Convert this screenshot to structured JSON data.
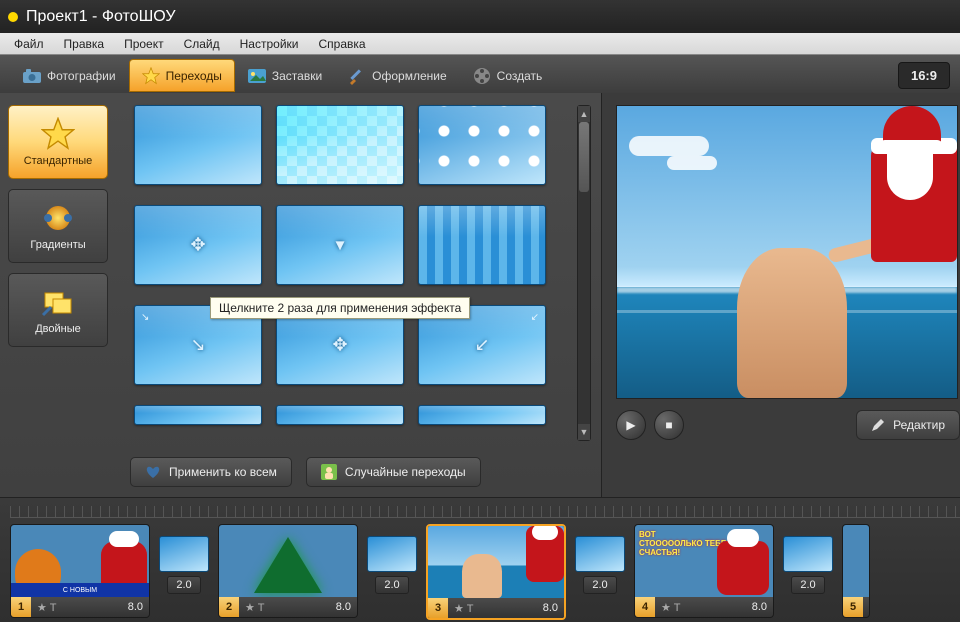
{
  "title": "Проект1 - ФотоШОУ",
  "menu": [
    "Файл",
    "Правка",
    "Проект",
    "Слайд",
    "Настройки",
    "Справка"
  ],
  "tabs": {
    "photos": "Фотографии",
    "transitions": "Переходы",
    "screens": "Заставки",
    "design": "Оформление",
    "create": "Создать"
  },
  "aspect": "16:9",
  "categories": {
    "standard": "Стандартные",
    "gradients": "Градиенты",
    "double": "Двойные"
  },
  "tooltip": "Щелкните 2 раза для применения эффекта",
  "buttons": {
    "apply_all": "Применить ко всем",
    "random": "Случайные переходы",
    "edit": "Редактир"
  },
  "timeline": {
    "slides": [
      {
        "n": "1",
        "dur": "8.0"
      },
      {
        "n": "2",
        "dur": "8.0"
      },
      {
        "n": "3",
        "dur": "8.0"
      },
      {
        "n": "4",
        "dur": "8.0"
      },
      {
        "n": "5",
        "dur": ""
      }
    ],
    "trans_dur": "2.0",
    "s1_ribbon": "С НОВЫМ",
    "s4_text": "ВОТ\nСТОООООЛЬКО ТЕБЕ\nСЧАСТЬЯ!"
  }
}
